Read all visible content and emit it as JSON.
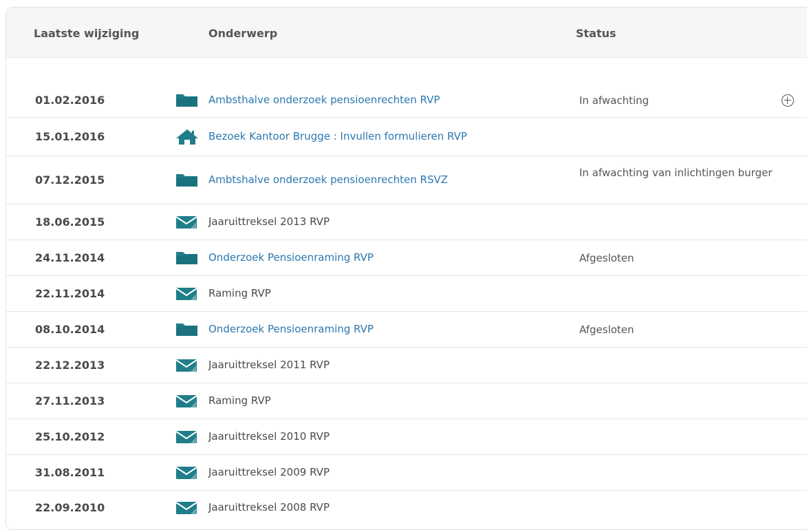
{
  "table": {
    "headers": {
      "date": "Laatste wijziging",
      "subject": "Onderwerp",
      "status": "Status"
    },
    "rows": [
      {
        "date": "01.02.2016",
        "icon": "folder-icon",
        "subject": "Ambsthalve onderzoek pensioenrechten RVP",
        "link": true,
        "status": "In afwachting",
        "expand": true
      },
      {
        "date": "15.01.2016",
        "icon": "house-icon",
        "subject": "Bezoek Kantoor Brugge : Invullen formulieren RVP",
        "link": true,
        "status": ""
      },
      {
        "date": "07.12.2015",
        "icon": "folder-icon",
        "subject": "Ambtshalve onderzoek pensioenrechten RSVZ",
        "link": true,
        "status": "In afwachting van inlichtingen burger"
      },
      {
        "date": "18.06.2015",
        "icon": "envelope-icon",
        "subject": "Jaaruittreksel 2013 RVP",
        "link": false,
        "status": ""
      },
      {
        "date": "24.11.2014",
        "icon": "folder-icon",
        "subject": "Onderzoek Pensioenraming RVP",
        "link": true,
        "status": "Afgesloten"
      },
      {
        "date": "22.11.2014",
        "icon": "envelope-icon",
        "subject": "Raming RVP",
        "link": false,
        "status": ""
      },
      {
        "date": "08.10.2014",
        "icon": "folder-icon",
        "subject": "Onderzoek Pensioenraming RVP",
        "link": true,
        "status": "Afgesloten"
      },
      {
        "date": "22.12.2013",
        "icon": "envelope-icon",
        "subject": "Jaaruittreksel 2011 RVP",
        "link": false,
        "status": ""
      },
      {
        "date": "27.11.2013",
        "icon": "envelope-icon",
        "subject": "Raming RVP",
        "link": false,
        "status": ""
      },
      {
        "date": "25.10.2012",
        "icon": "envelope-icon",
        "subject": "Jaaruittreksel 2010 RVP",
        "link": false,
        "status": ""
      },
      {
        "date": "31.08.2011",
        "icon": "envelope-icon",
        "subject": "Jaaruittreksel 2009 RVP",
        "link": false,
        "status": ""
      },
      {
        "date": "22.09.2010",
        "icon": "envelope-icon",
        "subject": "Jaaruittreksel 2008 RVP",
        "link": false,
        "status": ""
      }
    ]
  },
  "colors": {
    "icon": "#1f7e8a",
    "link": "#2b77b0"
  }
}
